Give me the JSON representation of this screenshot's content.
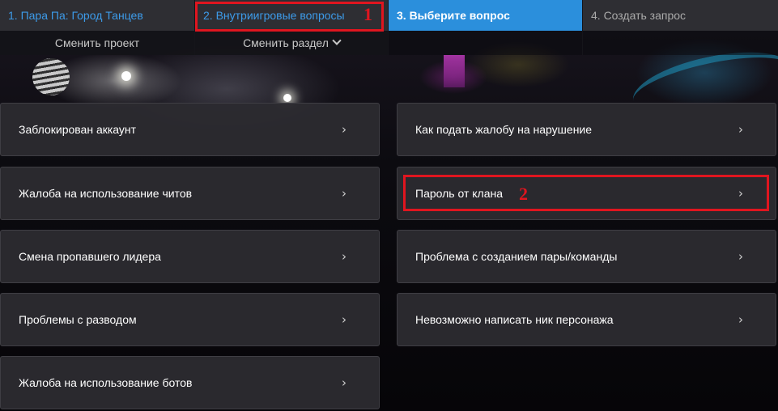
{
  "steps": [
    {
      "label": "1. Пара Па: Город Танцев",
      "sub": "Сменить проект"
    },
    {
      "label": "2. Внутриигровые вопросы",
      "sub": "Сменить раздел"
    },
    {
      "label": "3. Выберите вопрос",
      "sub": ""
    },
    {
      "label": "4. Создать запрос",
      "sub": ""
    }
  ],
  "annotations": {
    "one": "1",
    "two": "2",
    "color": "#e0151f"
  },
  "questions_left": [
    "Заблокирован аккаунт",
    "Жалоба на использование читов",
    "Смена пропавшего лидера",
    "Проблемы с разводом",
    "Жалоба на использование ботов"
  ],
  "questions_right": [
    "Как подать жалобу на нарушение",
    "Пароль от клана",
    "Проблема с созданием пары/команды",
    "Невозможно написать ник персонажа"
  ],
  "arrow_glyph": "›",
  "colors": {
    "active_step": "#2b8fdc",
    "link_step": "#3d9be9",
    "card_bg": "#2c2b30"
  }
}
